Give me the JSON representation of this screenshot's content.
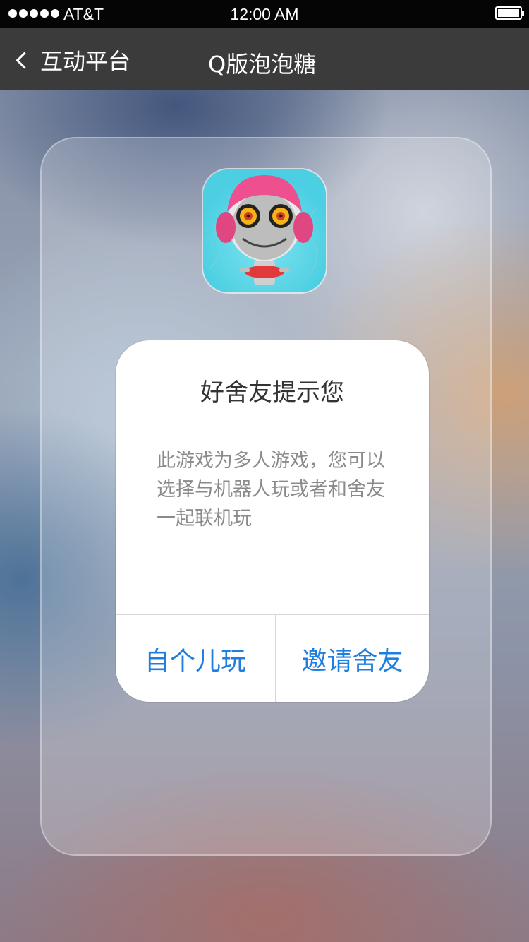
{
  "status_bar": {
    "carrier": "AT&T",
    "time": "12:00 AM",
    "signal_bars": 5
  },
  "nav": {
    "back_label": "互动平台",
    "title": "Q版泡泡糖"
  },
  "game_icon": "robot-character-icon",
  "dialog": {
    "title": "好舍友提示您",
    "message": "此游戏为多人游戏，您可以选择与机器人玩或者和舍友一起联机玩",
    "buttons": {
      "solo": "自个儿玩",
      "invite": "邀请舍友"
    }
  },
  "colors": {
    "accent": "#1f7fe0",
    "nav_background": "#3b3b3b",
    "status_background": "#050505"
  }
}
